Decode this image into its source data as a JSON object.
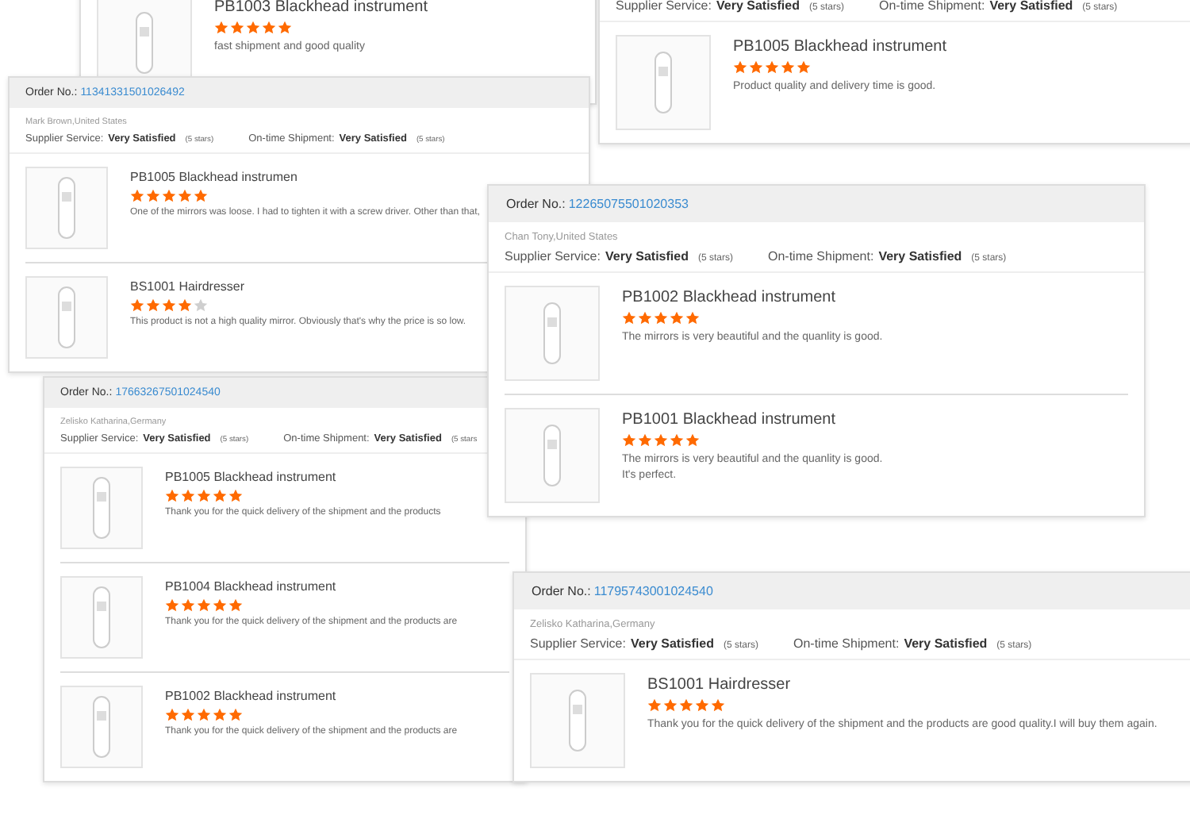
{
  "cards": [
    {
      "items": [
        {
          "name": "PB1003 Blackhead instrument",
          "stars": 5,
          "comment": "fast shipment and good quality"
        }
      ]
    },
    {
      "ratings": [
        {
          "label": "Supplier Service:",
          "value": "Very Satisfied",
          "note": "(5 stars)"
        },
        {
          "label": "On-time Shipment:",
          "value": "Very Satisfied",
          "note": "(5 stars)"
        }
      ],
      "items": [
        {
          "name": "PB1005 Blackhead instrument",
          "stars": 5,
          "comment": "Product quality and delivery time is good."
        }
      ]
    },
    {
      "order_label": "Order No.:",
      "order_no": "11341331501026492",
      "buyer": "Mark Brown,United States",
      "ratings": [
        {
          "label": "Supplier Service:",
          "value": "Very Satisfied",
          "note": "(5 stars)"
        },
        {
          "label": "On-time Shipment:",
          "value": "Very Satisfied",
          "note": "(5 stars)"
        }
      ],
      "items": [
        {
          "name": "PB1005 Blackhead instrumen",
          "stars": 5,
          "comment": "One of the mirrors was loose. I had to tighten it with a screw driver. Other than that,"
        },
        {
          "name": "BS1001 Hairdresser",
          "stars": 4,
          "comment": "This product is not a high quality mirror. Obviously that's why the price is so low."
        }
      ]
    },
    {
      "order_label": "Order No.:",
      "order_no": "17663267501024540",
      "buyer": "Zelisko Katharina,Germany",
      "ratings": [
        {
          "label": "Supplier Service:",
          "value": "Very Satisfied",
          "note": "(5 stars)"
        },
        {
          "label": "On-time Shipment:",
          "value": "Very Satisfied",
          "note": "(5 stars"
        }
      ],
      "items": [
        {
          "name": "PB1005 Blackhead instrument",
          "stars": 5,
          "comment": "Thank you for the quick delivery of the shipment and the products"
        },
        {
          "name": "PB1004 Blackhead instrument",
          "stars": 5,
          "comment": "Thank you for the quick delivery of the shipment and the products are"
        },
        {
          "name": "PB1002 Blackhead instrument",
          "stars": 5,
          "comment": "Thank you for the quick delivery of the shipment and the products are"
        }
      ]
    },
    {
      "order_label": "Order No.:",
      "order_no": "12265075501020353",
      "buyer": "Chan Tony,United States",
      "ratings": [
        {
          "label": "Supplier Service:",
          "value": "Very Satisfied",
          "note": "(5 stars)"
        },
        {
          "label": "On-time Shipment:",
          "value": "Very Satisfied",
          "note": "(5 stars)"
        }
      ],
      "items": [
        {
          "name": "PB1002 Blackhead instrument",
          "stars": 5,
          "comment": "The mirrors is very beautiful and the quanlity is good."
        },
        {
          "name": "PB1001 Blackhead instrument",
          "stars": 5,
          "comment": "The mirrors is very beautiful and the quanlity is good.\nIt's perfect."
        }
      ]
    },
    {
      "order_label": "Order No.:",
      "order_no": "11795743001024540",
      "buyer": "Zelisko Katharina,Germany",
      "ratings": [
        {
          "label": "Supplier Service:",
          "value": "Very Satisfied",
          "note": "(5 stars)"
        },
        {
          "label": "On-time Shipment:",
          "value": "Very Satisfied",
          "note": "(5 stars)"
        }
      ],
      "items": [
        {
          "name": "BS1001 Hairdresser",
          "stars": 5,
          "comment": "Thank you for the quick delivery of the shipment and the products are good quality.I will buy them again."
        }
      ]
    }
  ]
}
